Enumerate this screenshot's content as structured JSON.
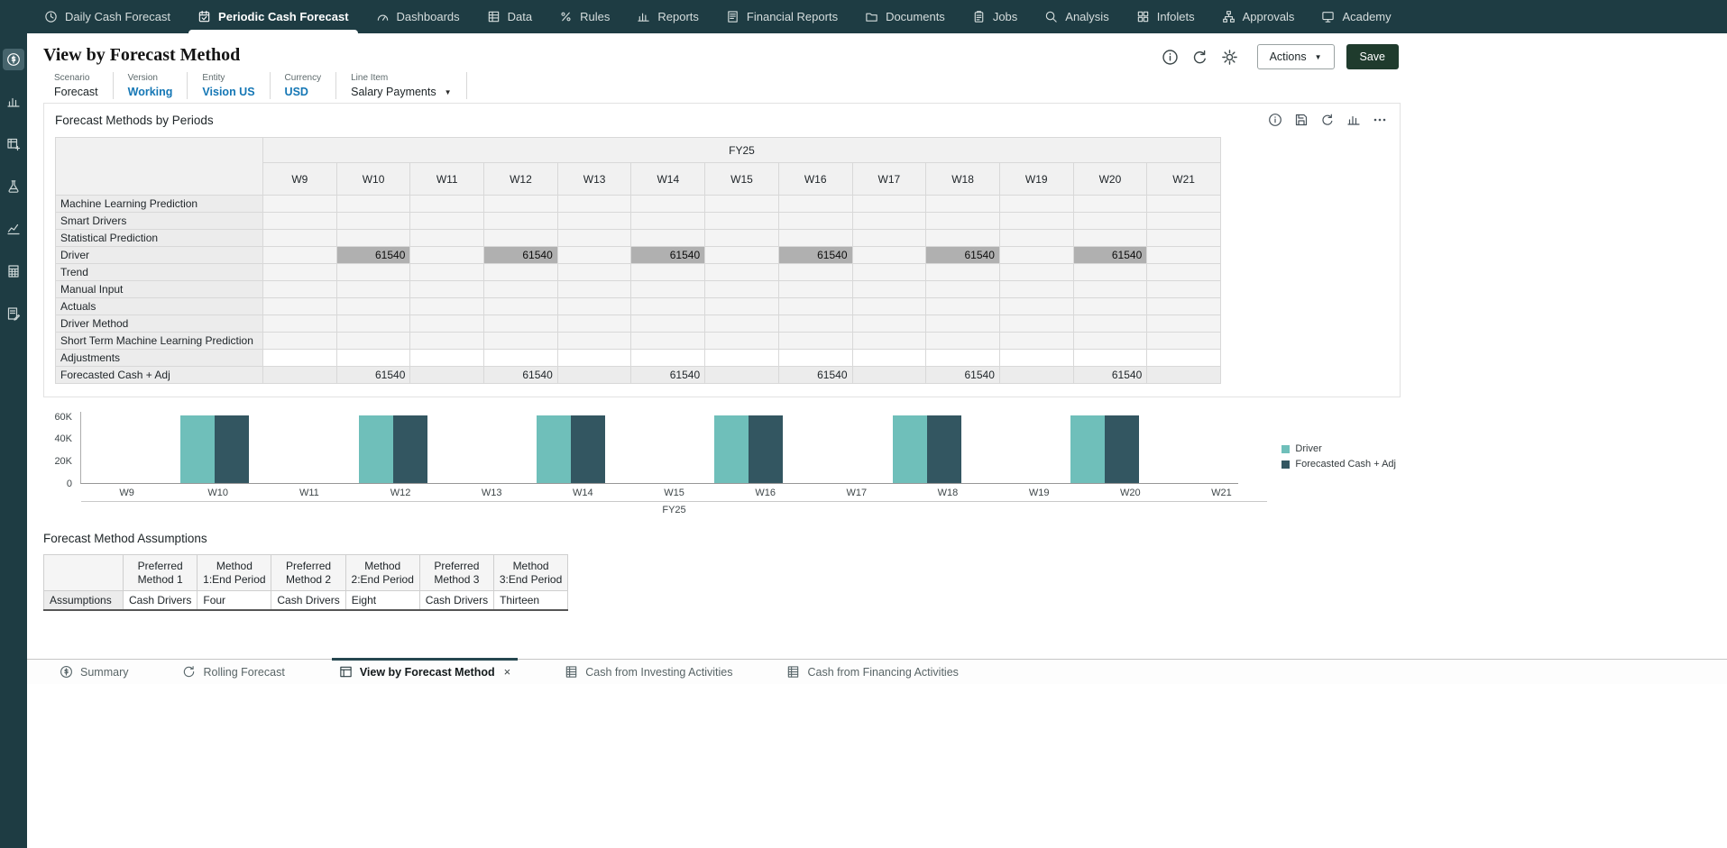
{
  "colors": {
    "nav_bg": "#1e3c43",
    "accent_link": "#1577b5",
    "save_bg": "#1f3b2d",
    "bar_teal": "#6fbfba",
    "bar_dark": "#335661",
    "highlight_cell": "#b0b0b0"
  },
  "topnav": {
    "tabs": [
      {
        "label": "Daily Cash Forecast",
        "icon": "clock",
        "active": false
      },
      {
        "label": "Periodic Cash Forecast",
        "icon": "calendar-check",
        "active": true
      },
      {
        "label": "Dashboards",
        "icon": "gauge",
        "active": false
      },
      {
        "label": "Data",
        "icon": "table",
        "active": false
      },
      {
        "label": "Rules",
        "icon": "percent",
        "active": false
      },
      {
        "label": "Reports",
        "icon": "bar-chart",
        "active": false
      },
      {
        "label": "Financial Reports",
        "icon": "doc-lines",
        "active": false
      },
      {
        "label": "Documents",
        "icon": "folder",
        "active": false
      },
      {
        "label": "Jobs",
        "icon": "clipboard",
        "active": false
      },
      {
        "label": "Analysis",
        "icon": "search",
        "active": false
      },
      {
        "label": "Infolets",
        "icon": "grid",
        "active": false
      },
      {
        "label": "Approvals",
        "icon": "flow",
        "active": false
      },
      {
        "label": "Academy",
        "icon": "monitor",
        "active": false
      }
    ]
  },
  "sidebar": {
    "items": [
      {
        "icon": "coins",
        "active": true
      },
      {
        "icon": "bar-chart",
        "active": false
      },
      {
        "icon": "table-plus",
        "active": false
      },
      {
        "icon": "flask",
        "active": false
      },
      {
        "icon": "trend",
        "active": false
      },
      {
        "icon": "calc",
        "active": false
      },
      {
        "icon": "doc-edit",
        "active": false
      }
    ]
  },
  "header": {
    "title": "View by Forecast Method",
    "icons": [
      "info",
      "refresh",
      "gear"
    ],
    "actions_label": "Actions",
    "save_label": "Save"
  },
  "pov": {
    "items": [
      {
        "label": "Scenario",
        "value": "Forecast",
        "link": false,
        "dropdown": false
      },
      {
        "label": "Version",
        "value": "Working",
        "link": true,
        "dropdown": false
      },
      {
        "label": "Entity",
        "value": "Vision US",
        "link": true,
        "dropdown": false
      },
      {
        "label": "Currency",
        "value": "USD",
        "link": true,
        "dropdown": false
      },
      {
        "label": "Line Item",
        "value": "Salary Payments",
        "link": false,
        "dropdown": true
      }
    ]
  },
  "grid": {
    "title": "Forecast Methods by Periods",
    "toolbar_icons": [
      "info",
      "save",
      "refresh",
      "bar-chart",
      "ellipsis"
    ],
    "year_header": "FY25",
    "columns": [
      "W9",
      "W10",
      "W11",
      "W12",
      "W13",
      "W14",
      "W15",
      "W16",
      "W17",
      "W18",
      "W19",
      "W20",
      "W21"
    ],
    "rows": [
      {
        "label": "Machine Learning Prediction",
        "style": "readonly",
        "highlight": false,
        "values": [
          "",
          "",
          "",
          "",
          "",
          "",
          "",
          "",
          "",
          "",
          "",
          "",
          ""
        ]
      },
      {
        "label": "Smart Drivers",
        "style": "readonly",
        "highlight": false,
        "values": [
          "",
          "",
          "",
          "",
          "",
          "",
          "",
          "",
          "",
          "",
          "",
          "",
          ""
        ]
      },
      {
        "label": "Statistical Prediction",
        "style": "readonly",
        "highlight": false,
        "values": [
          "",
          "",
          "",
          "",
          "",
          "",
          "",
          "",
          "",
          "",
          "",
          "",
          ""
        ]
      },
      {
        "label": "Driver",
        "style": "readonly",
        "highlight": true,
        "values": [
          "",
          "61540",
          "",
          "61540",
          "",
          "61540",
          "",
          "61540",
          "",
          "61540",
          "",
          "61540",
          ""
        ]
      },
      {
        "label": "Trend",
        "style": "readonly",
        "highlight": false,
        "values": [
          "",
          "",
          "",
          "",
          "",
          "",
          "",
          "",
          "",
          "",
          "",
          "",
          ""
        ]
      },
      {
        "label": "Manual Input",
        "style": "readonly",
        "highlight": false,
        "values": [
          "",
          "",
          "",
          "",
          "",
          "",
          "",
          "",
          "",
          "",
          "",
          "",
          ""
        ]
      },
      {
        "label": "Actuals",
        "style": "readonly",
        "highlight": false,
        "values": [
          "",
          "",
          "",
          "",
          "",
          "",
          "",
          "",
          "",
          "",
          "",
          "",
          ""
        ]
      },
      {
        "label": "Driver Method",
        "style": "readonly",
        "highlight": false,
        "values": [
          "",
          "",
          "",
          "",
          "",
          "",
          "",
          "",
          "",
          "",
          "",
          "",
          ""
        ]
      },
      {
        "label": "Short Term Machine Learning Prediction",
        "style": "readonly",
        "highlight": false,
        "values": [
          "",
          "",
          "",
          "",
          "",
          "",
          "",
          "",
          "",
          "",
          "",
          "",
          ""
        ]
      },
      {
        "label": "Adjustments",
        "style": "input",
        "highlight": false,
        "values": [
          "",
          "",
          "",
          "",
          "",
          "",
          "",
          "",
          "",
          "",
          "",
          "",
          ""
        ]
      },
      {
        "label": "Forecasted Cash + Adj",
        "style": "total",
        "highlight": false,
        "values": [
          "",
          "61540",
          "",
          "61540",
          "",
          "61540",
          "",
          "61540",
          "",
          "61540",
          "",
          "61540",
          ""
        ]
      }
    ]
  },
  "chart_data": {
    "type": "bar",
    "title": "",
    "categories": [
      "W9",
      "W10",
      "W11",
      "W12",
      "W13",
      "W14",
      "W15",
      "W16",
      "W17",
      "W18",
      "W19",
      "W20",
      "W21"
    ],
    "series": [
      {
        "name": "Driver",
        "color": "#6fbfba",
        "values": [
          null,
          61540,
          null,
          61540,
          null,
          61540,
          null,
          61540,
          null,
          61540,
          null,
          61540,
          null
        ]
      },
      {
        "name": "Forecasted Cash + Adj",
        "color": "#335661",
        "values": [
          null,
          61540,
          null,
          61540,
          null,
          61540,
          null,
          61540,
          null,
          61540,
          null,
          61540,
          null
        ]
      }
    ],
    "xlabel": "FY25",
    "ylabel": "",
    "ylim": [
      0,
      65000
    ],
    "yticks": [
      {
        "value": 0,
        "label": "0"
      },
      {
        "value": 20000,
        "label": "20K"
      },
      {
        "value": 40000,
        "label": "40K"
      },
      {
        "value": 60000,
        "label": "60K"
      }
    ],
    "legend_position": "right",
    "grid": false
  },
  "assumptions": {
    "title": "Forecast Method Assumptions",
    "columns": [
      "",
      "Preferred Method 1",
      "Method 1:End Period",
      "Preferred Method 2",
      "Method 2:End Period",
      "Preferred Method 3",
      "Method 3:End Period"
    ],
    "rows": [
      {
        "label": "Assumptions",
        "values": [
          "Cash Drivers",
          "Four",
          "Cash Drivers",
          "Eight",
          "Cash Drivers",
          "Thirteen"
        ]
      }
    ]
  },
  "bottom_tabs": [
    {
      "label": "Summary",
      "icon": "circle-dollar",
      "active": false,
      "closable": false
    },
    {
      "label": "Rolling Forecast",
      "icon": "circle-refresh",
      "active": false,
      "closable": false
    },
    {
      "label": "View by Forecast Method",
      "icon": "form",
      "active": true,
      "closable": true
    },
    {
      "label": "Cash from Investing Activities",
      "icon": "ledger",
      "active": false,
      "closable": false
    },
    {
      "label": "Cash from Financing Activities",
      "icon": "ledger",
      "active": false,
      "closable": false
    }
  ],
  "misc": {
    "close_glyph": "×",
    "caret_glyph": "▼"
  }
}
